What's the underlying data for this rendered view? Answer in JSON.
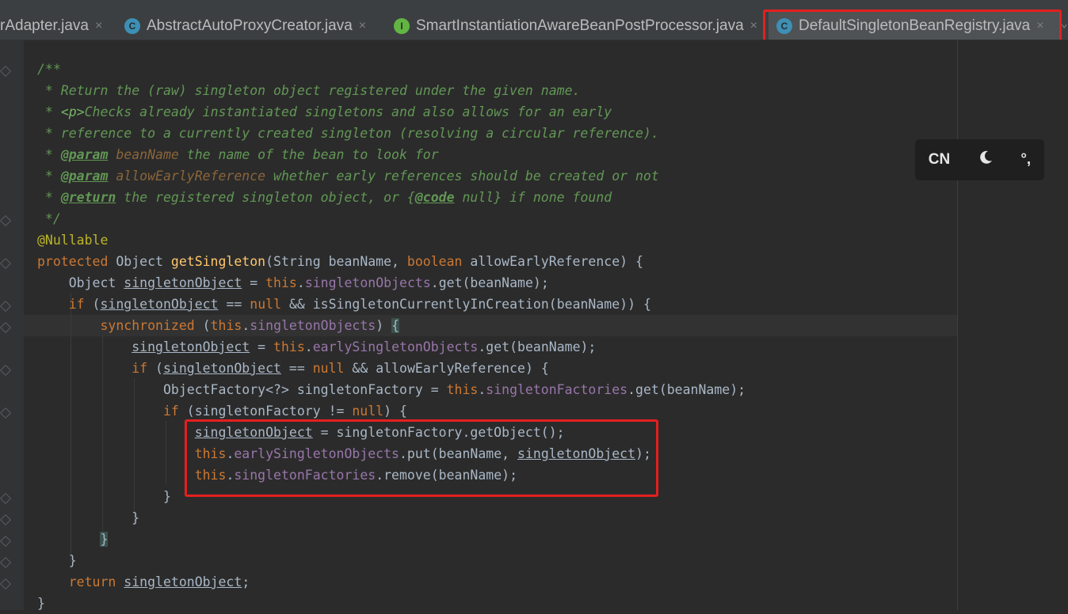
{
  "tabs": [
    {
      "label": "rAdapter.java",
      "icon": "none",
      "active": false
    },
    {
      "label": "AbstractAutoProxyCreator.java",
      "icon": "class-icon",
      "active": false
    },
    {
      "label": "SmartInstantiationAwareBeanPostProcessor.java",
      "icon": "interface-icon",
      "active": false
    },
    {
      "label": "DefaultSingletonBeanRegistry.java",
      "icon": "class-icon",
      "active": true
    }
  ],
  "icons": {
    "class_glyph": "C",
    "interface_glyph": "I",
    "close": "×",
    "overflow": "⌄"
  },
  "overlay": {
    "lang": "CN",
    "theme_icon": "moon-icon",
    "punct": "°,"
  },
  "code": {
    "doc_open": "/**",
    "doc1": " * Return the (raw) singleton object registered under the given name.",
    "doc2_star": " * ",
    "doc2_p": "<p>",
    "doc2_rest": "Checks already instantiated singletons and also allows for an early",
    "doc3": " * reference to a currently created singleton (resolving a circular reference).",
    "doc_star": " * ",
    "tag_param": "@param",
    "p1_name": "beanName",
    "p1_desc": " the name of the bean to look for",
    "p2_name": "allowEarlyReference",
    "p2_desc": " whether early references should be created or not",
    "tag_return": "@return",
    "ret_desc": " the registered singleton object, or ",
    "code_open": "{",
    "tag_code": "@code",
    "code_null": " null",
    "code_close": "}",
    "ret_tail": " if none found",
    "doc_close": " */",
    "annotation": "@Nullable",
    "kw_protected": "protected",
    "kw_boolean": "boolean",
    "kw_if": "if",
    "kw_null": "null",
    "kw_sync": "synchronized",
    "kw_this": "this",
    "kw_return": "return",
    "t_object": " Object ",
    "fn_getSingleton": "getSingleton",
    "sig_a": "(String beanName, ",
    "sig_b": " allowEarlyReference) {",
    "indent1": "    ",
    "indent2": "        ",
    "indent3": "            ",
    "indent4": "                ",
    "indent5": "                    ",
    "t_object2": "Object ",
    "v_so": "singletonObject",
    "eq_this": " = ",
    "dot": ".",
    "f_so": "singletonObjects",
    "get_bn": ".get(beanName);",
    "space": " ",
    "paren_open": " (",
    "eqeq": " == ",
    "and_isc": " && isSingletonCurrentlyInCreation(beanName)) {",
    "sync_paren": " (",
    "sync_close": ") ",
    "brace_open": "{",
    "brace_close": "}",
    "f_eso": "earlySingletonObjects",
    "and_aer": " && allowEarlyReference) {",
    "of_decl": "ObjectFactory<?> singletonFactory = ",
    "f_sf": "singletonFactories",
    "sf_null_a": " (singletonFactory != ",
    "sf_null_b": ") {",
    "get_obj": " = singletonFactory.getObject();",
    "put_a": ".put(beanName, ",
    "put_b": ");",
    "remove_bn": ".remove(beanName);",
    "semi": ";"
  }
}
